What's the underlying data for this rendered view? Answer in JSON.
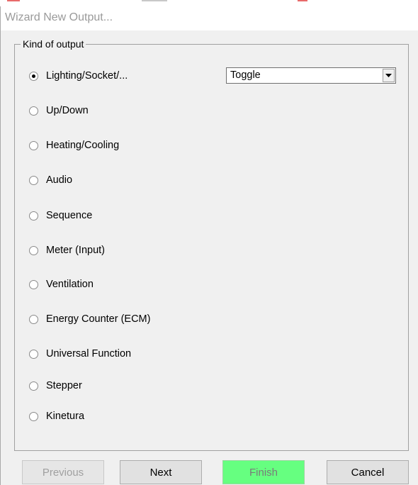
{
  "window": {
    "title": "Wizard New Output..."
  },
  "group": {
    "legend": "Kind of output"
  },
  "options": [
    {
      "label": "Lighting/Socket/...",
      "checked": true
    },
    {
      "label": "Up/Down",
      "checked": false
    },
    {
      "label": "Heating/Cooling",
      "checked": false
    },
    {
      "label": "Audio",
      "checked": false
    },
    {
      "label": "Sequence",
      "checked": false
    },
    {
      "label": "Meter (Input)",
      "checked": false
    },
    {
      "label": "Ventilation",
      "checked": false
    },
    {
      "label": "Energy Counter (ECM)",
      "checked": false
    },
    {
      "label": "Universal Function",
      "checked": false
    },
    {
      "label": "Stepper",
      "checked": false
    },
    {
      "label": "Kinetura",
      "checked": false
    }
  ],
  "mode_select": {
    "value": "Toggle"
  },
  "buttons": {
    "previous": "Previous",
    "next": "Next",
    "finish": "Finish",
    "cancel": "Cancel"
  },
  "colors": {
    "finish_bg": "#66ff80",
    "window_bg": "#f0f0f0",
    "title_text": "#9a9a9a",
    "top_marks": [
      "#e86a6a",
      "#c8c8c8",
      "#e86a6a"
    ]
  }
}
